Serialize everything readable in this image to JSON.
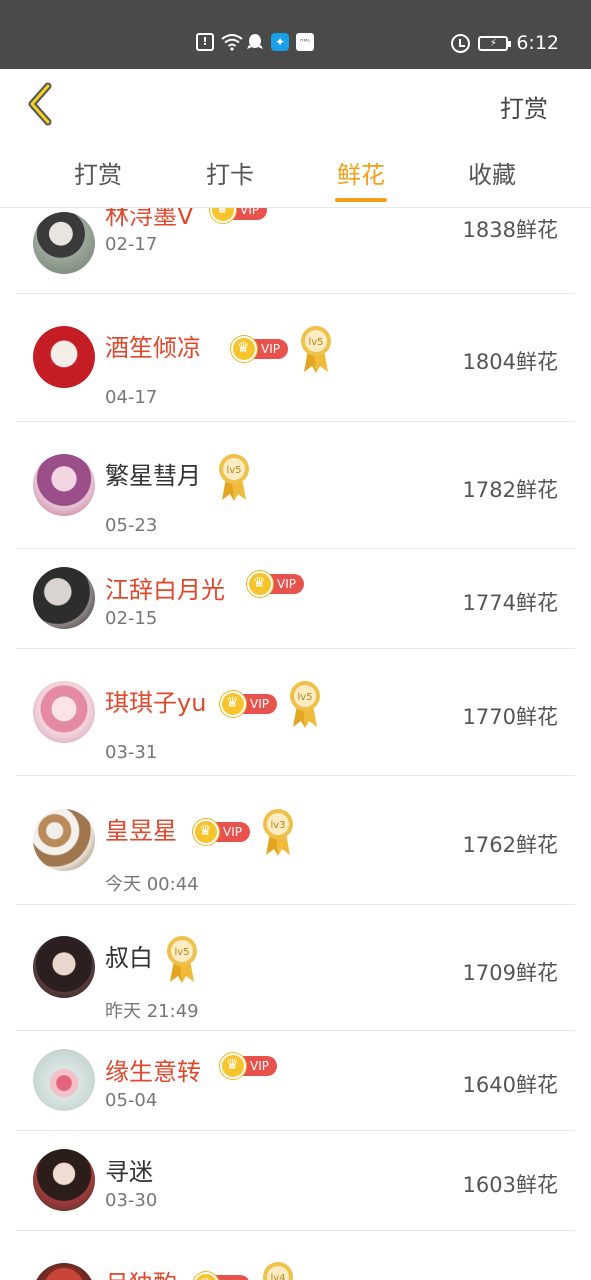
{
  "status_bar": {
    "time": "6:12",
    "icons": [
      "sim-alert-icon",
      "wifi-icon",
      "qq-icon",
      "app-icon",
      "app-icon",
      "alarm-icon",
      "battery-icon"
    ]
  },
  "header": {
    "right_label": "打赏"
  },
  "tabs": [
    {
      "label": "打赏"
    },
    {
      "label": "打卡"
    },
    {
      "label": "鲜花"
    },
    {
      "label": "收藏"
    }
  ],
  "active_tab": "鲜花",
  "colors": {
    "accent": "#f3a018",
    "vip_name": "#e0482c",
    "vip_tag": "#e8524d",
    "status_bar": "#4a4a4a"
  },
  "vip_label": "VIP",
  "rows": [
    {
      "name": "林浔墨V",
      "vip": true,
      "level": "",
      "date": "02-17",
      "amount": "1838鲜花"
    },
    {
      "name": "酒笙倾凉",
      "vip": true,
      "level": "lv5",
      "date": "04-17",
      "amount": "1804鲜花"
    },
    {
      "name": "繁星彗月",
      "vip": false,
      "level": "lv5",
      "date": "05-23",
      "amount": "1782鲜花"
    },
    {
      "name": "江辞白月光",
      "vip": true,
      "level": "",
      "date": "02-15",
      "amount": "1774鲜花"
    },
    {
      "name": "琪琪子yu",
      "vip": true,
      "level": "lv5",
      "date": "03-31",
      "amount": "1770鲜花"
    },
    {
      "name": "皇昱星",
      "vip": true,
      "level": "lv3",
      "date": "今天 00:44",
      "amount": "1762鲜花"
    },
    {
      "name": "叔白",
      "vip": false,
      "level": "lv5",
      "date": "昨天 21:49",
      "amount": "1709鲜花"
    },
    {
      "name": "缘生意转",
      "vip": true,
      "level": "",
      "date": "05-04",
      "amount": "1640鲜花"
    },
    {
      "name": "寻迷",
      "vip": false,
      "level": "",
      "date": "03-30",
      "amount": "1603鲜花"
    },
    {
      "name": "吕独酌",
      "vip": true,
      "level": "lv4",
      "date": "",
      "amount": ""
    }
  ]
}
